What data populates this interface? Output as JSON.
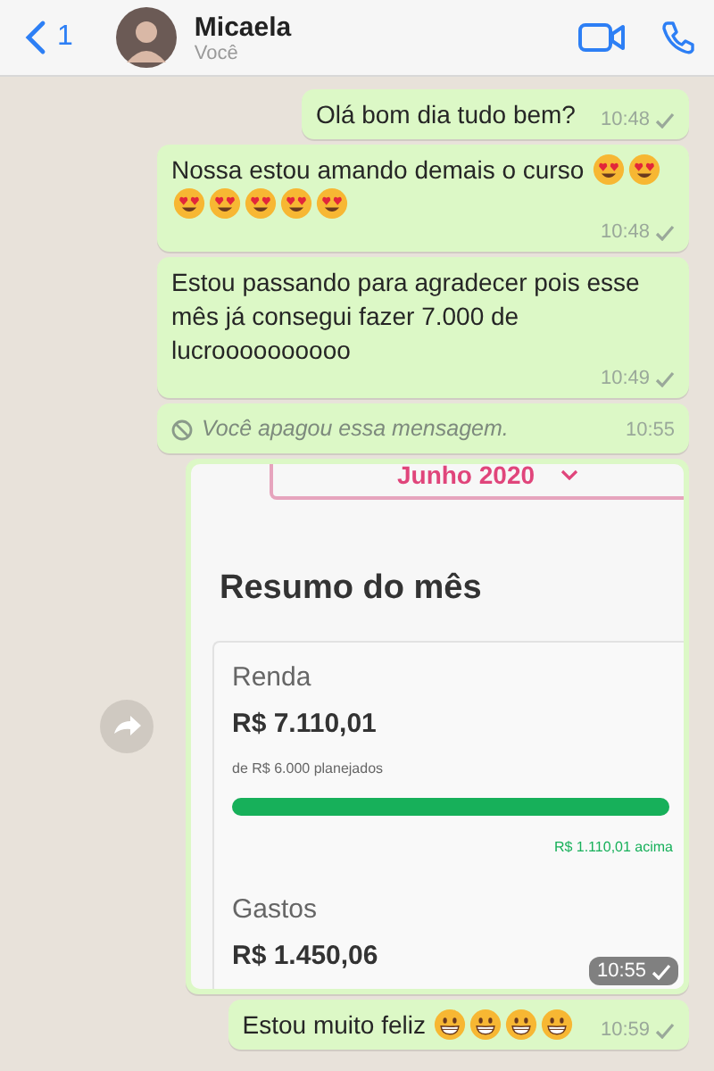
{
  "header": {
    "back_count": "1",
    "name": "Micaela",
    "subtitle": "Você"
  },
  "messages": [
    {
      "kind": "text",
      "text": "Olá bom dia tudo bem?",
      "time": "10:48",
      "sent": true
    },
    {
      "kind": "text",
      "text": "Nossa estou amando demais o curso",
      "emojis": [
        {
          "kind": "heart-eyes"
        },
        {
          "kind": "heart-eyes"
        },
        {
          "kind": "heart-eyes"
        },
        {
          "kind": "heart-eyes"
        },
        {
          "kind": "heart-eyes"
        },
        {
          "kind": "heart-eyes"
        },
        {
          "kind": "heart-eyes"
        }
      ],
      "time": "10:48",
      "sent": true
    },
    {
      "kind": "text",
      "text": "Estou passando para agradecer pois esse mês já consegui fazer 7.000 de lucroooooooooo",
      "time": "10:49",
      "sent": true
    },
    {
      "kind": "deleted",
      "text": "Você apagou essa mensagem.",
      "time": "10:55"
    },
    {
      "kind": "image",
      "time": "10:55",
      "sent": true,
      "screenshot": {
        "month": "Junho 2020",
        "title": "Resumo do mês",
        "income_label": "Renda",
        "income_value": "R$ 7.110,01",
        "planned": "de R$ 6.000 planejados",
        "level": 1,
        "over": "R$ 1.110,01 acima",
        "expense_label": "Gastos",
        "expense_value": "R$ 1.450,06"
      }
    },
    {
      "kind": "text",
      "text": "Estou muito feliz",
      "emojis": [
        {
          "kind": "grin"
        },
        {
          "kind": "grin"
        },
        {
          "kind": "grin"
        },
        {
          "kind": "grin"
        }
      ],
      "time": "10:59",
      "sent": true
    }
  ]
}
